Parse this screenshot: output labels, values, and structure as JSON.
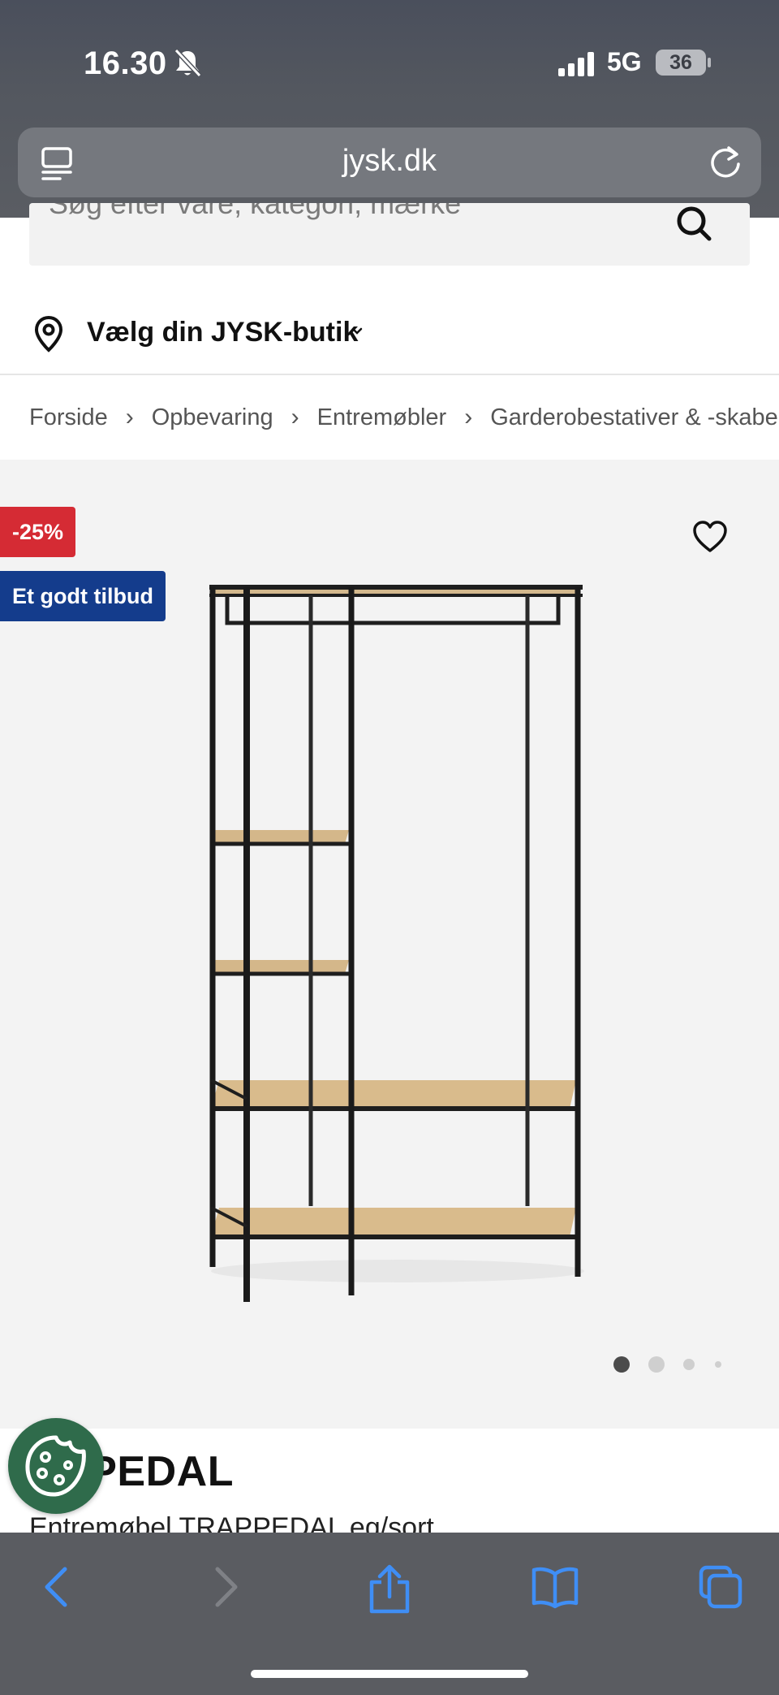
{
  "status_bar": {
    "time": "16.30",
    "network": "5G",
    "battery": "36"
  },
  "browser": {
    "url": "jysk.dk"
  },
  "search": {
    "placeholder": "Søg efter vare, kategori, mærke"
  },
  "store_selector": {
    "label": "Vælg din JYSK-butik"
  },
  "breadcrumb": [
    "Forside",
    "Opbevaring",
    "Entremøbler",
    "Garderobestativer & -skabe"
  ],
  "product": {
    "badges": {
      "discount": "-25%",
      "offer": "Et godt tilbud"
    },
    "title_visible": "APPEDAL",
    "subtitle": "Entremøbel TRAPPEDAL eg/sort",
    "gallery": {
      "image_count": 4,
      "active_index": 0
    }
  },
  "colors": {
    "accent_red": "#d52b34",
    "brand_blue": "#143c8c",
    "cookie_green": "#2f6b4b",
    "safari_blue": "#3f8ef5"
  },
  "icons": [
    "bell-slash-icon",
    "signal-icon",
    "tabs-icon",
    "reload-icon",
    "search-icon",
    "location-pin-icon",
    "chevron-down-icon",
    "heart-icon",
    "cookie-icon",
    "back-icon",
    "forward-icon",
    "share-icon",
    "bookmarks-icon",
    "tabs-overview-icon"
  ]
}
